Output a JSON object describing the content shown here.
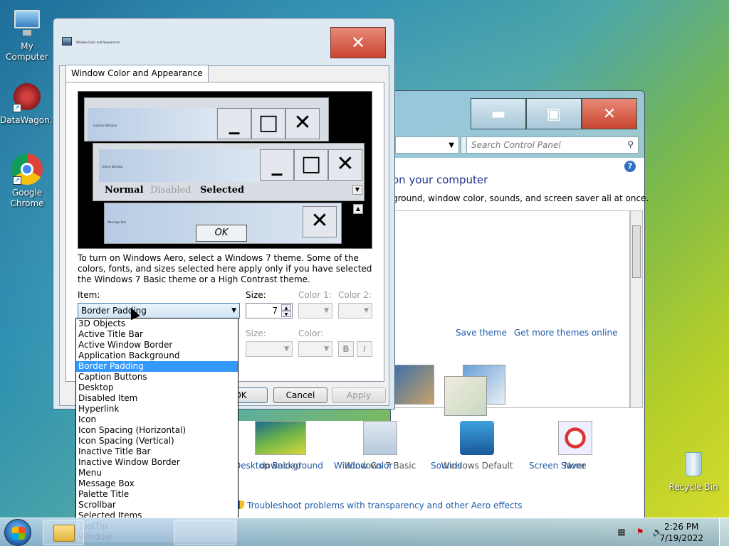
{
  "desktop": {
    "icons": [
      {
        "label": "My Computer"
      },
      {
        "label": "DataWagon..."
      },
      {
        "label": "Google Chrome"
      },
      {
        "label": "Recycle Bin"
      }
    ]
  },
  "control_panel": {
    "search_placeholder": "Search Control Panel",
    "heading": "on your computer",
    "subtitle": "ground, window color, sounds, and screen saver all at once.",
    "save_theme": "Save theme",
    "get_more_themes": "Get more themes online",
    "items": [
      {
        "label": "Desktop Background",
        "value": "download"
      },
      {
        "label": "Window Color",
        "value": "Windows 7 Basic"
      },
      {
        "label": "Sounds",
        "value": "Windows Default"
      },
      {
        "label": "Screen Saver",
        "value": "None"
      }
    ],
    "troubleshoot": "Troubleshoot problems with transparency and other Aero effects"
  },
  "dialog": {
    "title": "Window Color and Appearance",
    "tab": "Window Color and Appearance",
    "preview": {
      "inactive_title": "Inactive Window",
      "active_title": "Active Window",
      "menu_normal": "Normal",
      "menu_disabled": "Disabled",
      "menu_selected": "Selected",
      "message_title": "Message Box",
      "ok": "OK"
    },
    "info": "To turn on Windows Aero, select a Windows 7 theme.  Some of the colors, fonts, and sizes selected here apply only if you have selected the Windows 7 Basic theme or a High Contrast theme.",
    "item_label": "Item:",
    "item_value": "Border Padding",
    "size_label": "Size:",
    "size_value": "7",
    "color1_label": "Color 1:",
    "color2_label": "Color 2:",
    "font_size_label": "Size:",
    "font_color_label": "Color:",
    "bold": "B",
    "italic": "I",
    "ok": "OK",
    "cancel": "Cancel",
    "apply": "Apply",
    "item_options": [
      "3D Objects",
      "Active Title Bar",
      "Active Window Border",
      "Application Background",
      "Border Padding",
      "Caption Buttons",
      "Desktop",
      "Disabled Item",
      "Hyperlink",
      "Icon",
      "Icon Spacing (Horizontal)",
      "Icon Spacing (Vertical)",
      "Inactive Title Bar",
      "Inactive Window Border",
      "Menu",
      "Message Box",
      "Palette Title",
      "Scrollbar",
      "Selected Items",
      "ToolTip",
      "Window"
    ],
    "selected_index": 4
  },
  "taskbar": {
    "time": "2:26 PM",
    "date": "7/19/2022"
  }
}
